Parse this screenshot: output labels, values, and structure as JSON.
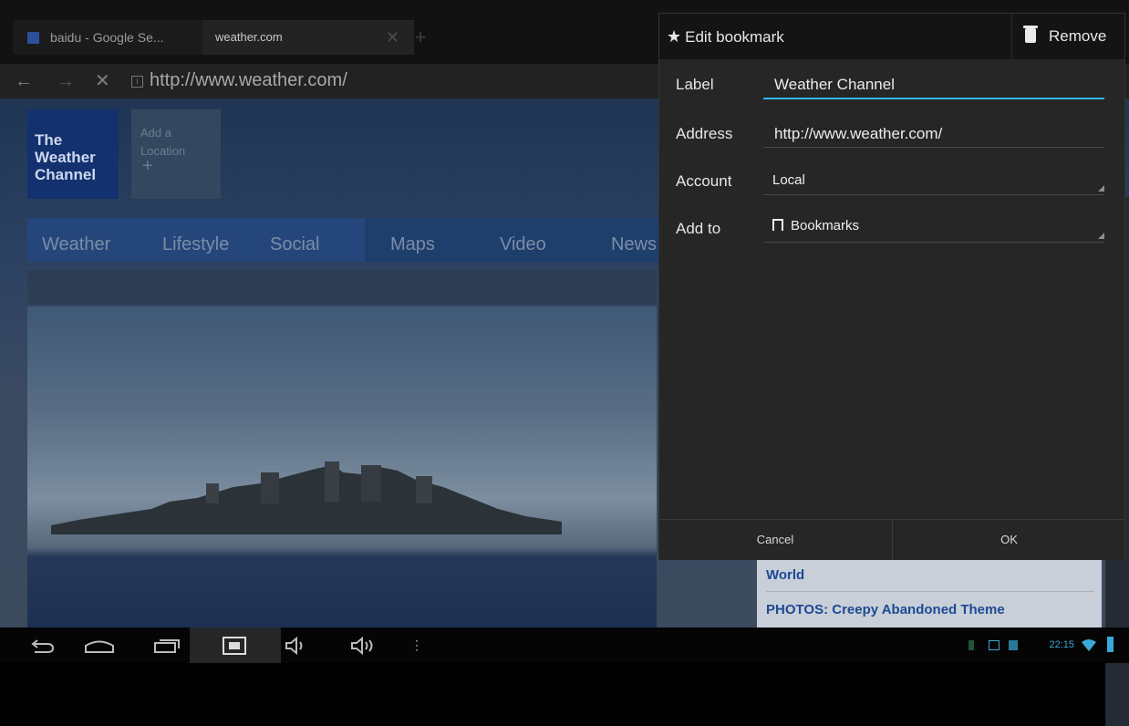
{
  "browser": {
    "tabs": [
      {
        "label": "baidu - Google Se..."
      },
      {
        "label": "weather.com"
      }
    ],
    "address": "http://www.weather.com/"
  },
  "page": {
    "logo_lines": [
      "The",
      "Weather",
      "Channel"
    ],
    "add_location": [
      "Add a",
      "Location"
    ],
    "nav_items": [
      "Weather",
      "Lifestyle",
      "Social",
      "Maps",
      "Video",
      "News"
    ],
    "side_links": [
      "World",
      "PHOTOS: Creepy Abandoned Theme"
    ]
  },
  "dialog": {
    "title": "Edit bookmark",
    "remove_label": "Remove",
    "fields": {
      "label": {
        "name": "Label",
        "value": "Weather Channel"
      },
      "address": {
        "name": "Address",
        "value": "http://www.weather.com/"
      },
      "account": {
        "name": "Account",
        "value": "Local"
      },
      "add_to": {
        "name": "Add to",
        "value": "Bookmarks"
      }
    },
    "cancel": "Cancel",
    "ok": "OK"
  },
  "system": {
    "clock": "22:15"
  },
  "colors": {
    "accent": "#33b5e5",
    "logo_bg": "#13316f",
    "link": "#1c4a94"
  },
  "icons": [
    "back-icon",
    "home-icon",
    "recent-apps-icon",
    "screenshot-icon",
    "volume-down-icon",
    "volume-up-icon",
    "menu-icon",
    "usb-icon",
    "wifi-icon",
    "battery-icon",
    "star-icon",
    "trash-icon",
    "bookmark-icon"
  ]
}
